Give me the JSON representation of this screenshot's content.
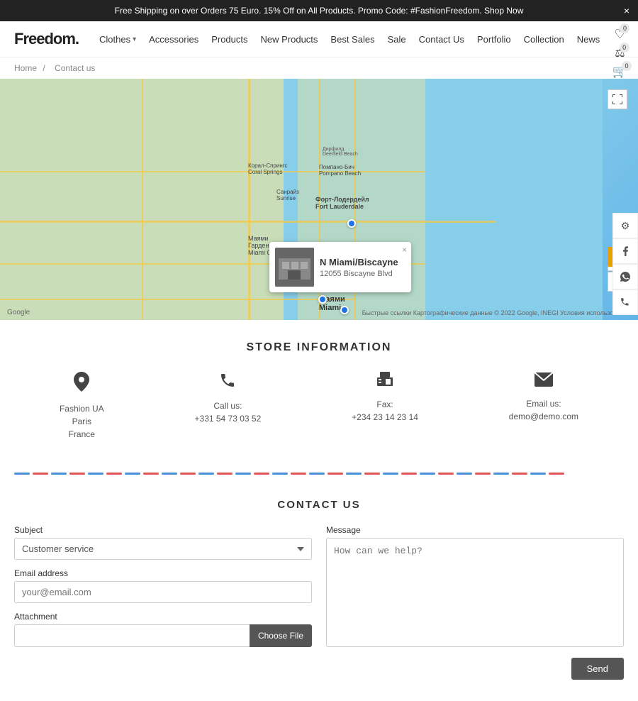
{
  "banner": {
    "text": "Free Shipping on over Orders 75 Euro. 15% Off on All Products. Promo Code: #FashionFreedom. Shop Now",
    "close_label": "×"
  },
  "header": {
    "logo": "Freedom.",
    "nav": [
      {
        "label": "Clothes",
        "has_dropdown": true
      },
      {
        "label": "Accessories",
        "has_dropdown": false
      },
      {
        "label": "Products",
        "has_dropdown": false
      },
      {
        "label": "New Products",
        "has_dropdown": false
      },
      {
        "label": "Best Sales",
        "has_dropdown": false
      },
      {
        "label": "Sale",
        "has_dropdown": false
      },
      {
        "label": "Contact Us",
        "has_dropdown": false
      },
      {
        "label": "Portfolio",
        "has_dropdown": false
      },
      {
        "label": "Collection",
        "has_dropdown": false
      },
      {
        "label": "News",
        "has_dropdown": false
      }
    ],
    "icons": {
      "wishlist_count": "0",
      "compare_count": "0",
      "cart_count": "0"
    }
  },
  "breadcrumb": {
    "home": "Home",
    "separator": "/",
    "current": "Contact us"
  },
  "map": {
    "popup": {
      "name": "N Miami/Biscayne",
      "address": "12055 Biscayne Blvd",
      "close_label": "×"
    },
    "logo": "Google",
    "attribution": "Быстрые ссылки  Картографические данные © 2022 Google, INEGI  Условия использования",
    "zoom_in": "+",
    "zoom_out": "−"
  },
  "store_info": {
    "title": "STORE INFORMATION",
    "items": [
      {
        "icon": "📍",
        "lines": [
          "Fashion UA",
          "Paris",
          "France"
        ]
      },
      {
        "icon": "📞",
        "lines": [
          "Call us:",
          "+331 54 73 03 52"
        ]
      },
      {
        "icon": "🖨",
        "lines": [
          "Fax:",
          "+234 23 14 23 14"
        ]
      },
      {
        "icon": "✉",
        "lines": [
          "Email us:",
          "demo@demo.com"
        ]
      }
    ]
  },
  "contact": {
    "title": "CONTACT US",
    "subject_label": "Subject",
    "subject_placeholder": "Customer service",
    "email_label": "Email address",
    "email_placeholder": "your@email.com",
    "attachment_label": "Attachment",
    "choose_file_label": "Choose File",
    "message_label": "Message",
    "message_placeholder": "How can we help?",
    "send_label": "Send"
  },
  "sidebar": {
    "icons": [
      "⚙",
      "f",
      "w",
      "📞"
    ]
  }
}
